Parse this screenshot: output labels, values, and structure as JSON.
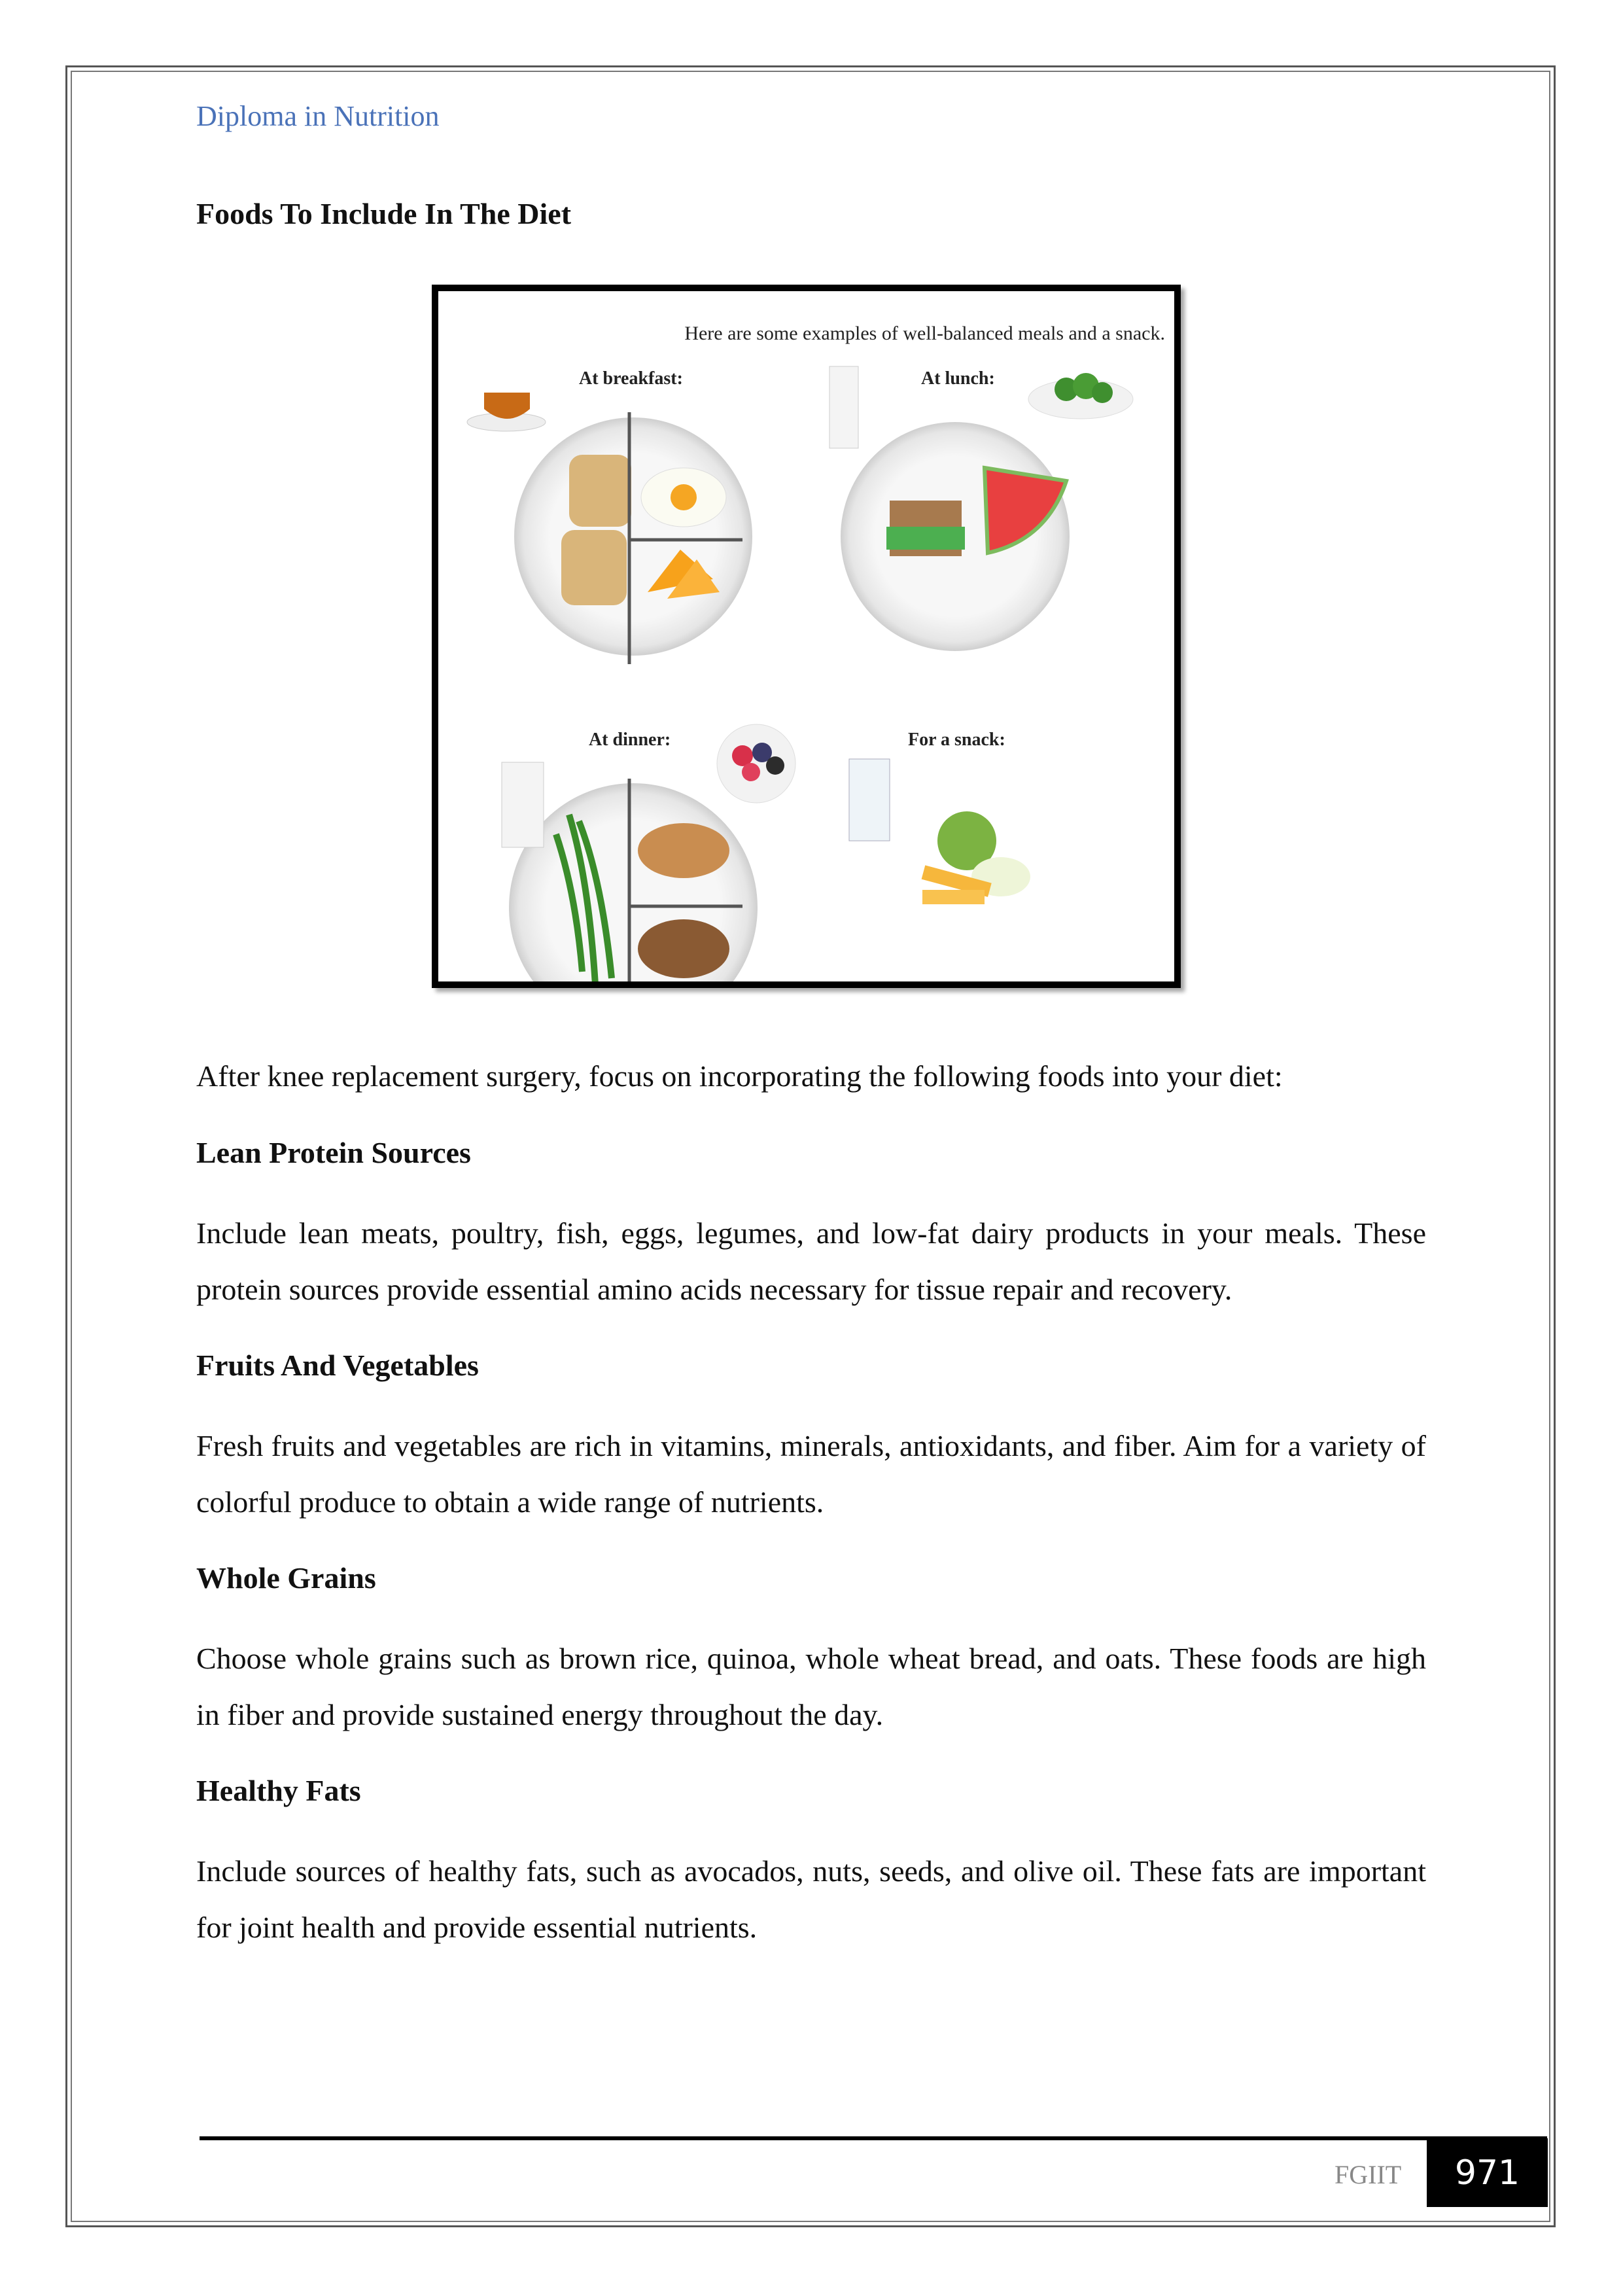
{
  "header": {
    "title": "Diploma in Nutrition",
    "color": "#4a72b8"
  },
  "section_title": "Foods To Include In The Diet",
  "figure": {
    "caption": "Here are some examples of well-balanced meals and a snack.",
    "labels": {
      "breakfast": "At breakfast:",
      "lunch": "At lunch:",
      "dinner": "At dinner:",
      "snack": "For a snack:"
    }
  },
  "intro": "After knee replacement surgery, focus on incorporating the following foods into your diet:",
  "sections": [
    {
      "title": "Lean Protein Sources",
      "body": "Include lean meats, poultry, fish, eggs, legumes, and low-fat dairy products in your meals. These protein sources provide essential amino acids necessary for tissue repair and recovery."
    },
    {
      "title": "Fruits And Vegetables",
      "body": "Fresh fruits and vegetables are rich in vitamins, minerals, antioxidants, and fiber. Aim for a variety of colorful produce to obtain a wide range of nutrients."
    },
    {
      "title": "Whole Grains",
      "body": "Choose whole grains such as brown rice, quinoa, whole wheat bread, and oats. These foods are high in fiber and provide sustained energy throughout the day."
    },
    {
      "title": "Healthy Fats",
      "body": "Include sources of healthy fats, such as avocados, nuts, seeds, and olive oil. These fats are important for joint health and provide essential nutrients."
    }
  ],
  "footer": {
    "brand": "FGIIT",
    "page_number": "971"
  }
}
